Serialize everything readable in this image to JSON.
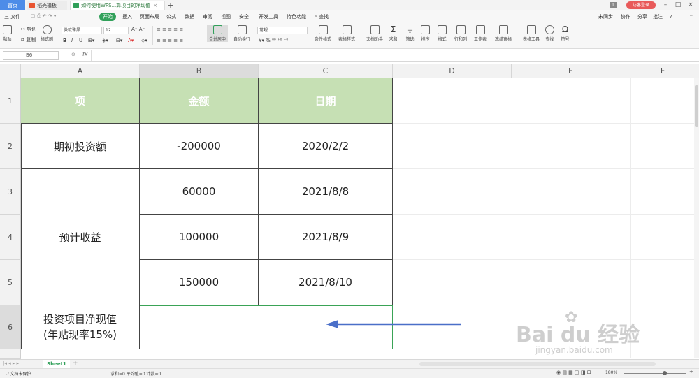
{
  "titlebar": {
    "tabs": [
      {
        "label": "首页"
      },
      {
        "label": "稻壳模板"
      },
      {
        "label": "如何使用WPS...算项目的净现值"
      }
    ],
    "add_tab": "+",
    "page_count": "1",
    "login_label": "访客登录"
  },
  "menubar": {
    "file_label": "三 文件",
    "items": [
      "开始",
      "插入",
      "页面布局",
      "公式",
      "数据",
      "审阅",
      "视图",
      "安全",
      "开发工具",
      "特色功能"
    ],
    "search_label": "查找",
    "sync_label": "未同步",
    "collab_label": "协作",
    "share_label": "分享",
    "comment_label": "批注"
  },
  "ribbon": {
    "paste": "粘贴",
    "cut": "剪切",
    "copy": "复制",
    "format_painter": "格式刷",
    "font_name": "微软雅黑",
    "font_size": "12",
    "merge_center": "合并居中",
    "wrap_text": "自动换行",
    "number_format": "常规",
    "cond_format": "条件格式",
    "table_style": "表格样式",
    "doc_helper": "文档助手",
    "sum": "求和",
    "filter": "筛选",
    "sort": "排序",
    "format": "格式",
    "row_col": "行和列",
    "worksheet": "工作表",
    "freeze": "冻结窗格",
    "table_tools": "表格工具",
    "find": "查找",
    "symbol": "符号"
  },
  "formula_bar": {
    "cell_ref": "B6",
    "fx": "fx"
  },
  "columns": [
    "A",
    "B",
    "C",
    "D",
    "E",
    "F"
  ],
  "rows": [
    "1",
    "2",
    "3",
    "4",
    "5",
    "6"
  ],
  "table": {
    "headers": [
      "项",
      "金额",
      "日期"
    ],
    "row2": {
      "item": "期初投资额",
      "amount": "-200000",
      "date": "2020/2/2"
    },
    "group_label": "预计收益",
    "row3": {
      "amount": "60000",
      "date": "2021/8/8"
    },
    "row4": {
      "amount": "100000",
      "date": "2021/8/9"
    },
    "row5": {
      "amount": "150000",
      "date": "2021/8/10"
    },
    "row6": {
      "line1": "投资项目净现值",
      "line2": "(年贴现率15%)",
      "amount": ""
    }
  },
  "sheets": [
    {
      "label": "Sheet1"
    }
  ],
  "status": {
    "protect": "文档未保护",
    "summary": "求和=0  平均值=0  计数=0",
    "zoom": "180%"
  },
  "watermark": {
    "brand": "Bai du 经验",
    "url": "jingyan.baidu.com"
  },
  "colors": {
    "header_green": "#c6e0b4",
    "accent_green": "#31a05a",
    "arrow_blue": "#4a6fc8",
    "selection": "#3aa356"
  }
}
